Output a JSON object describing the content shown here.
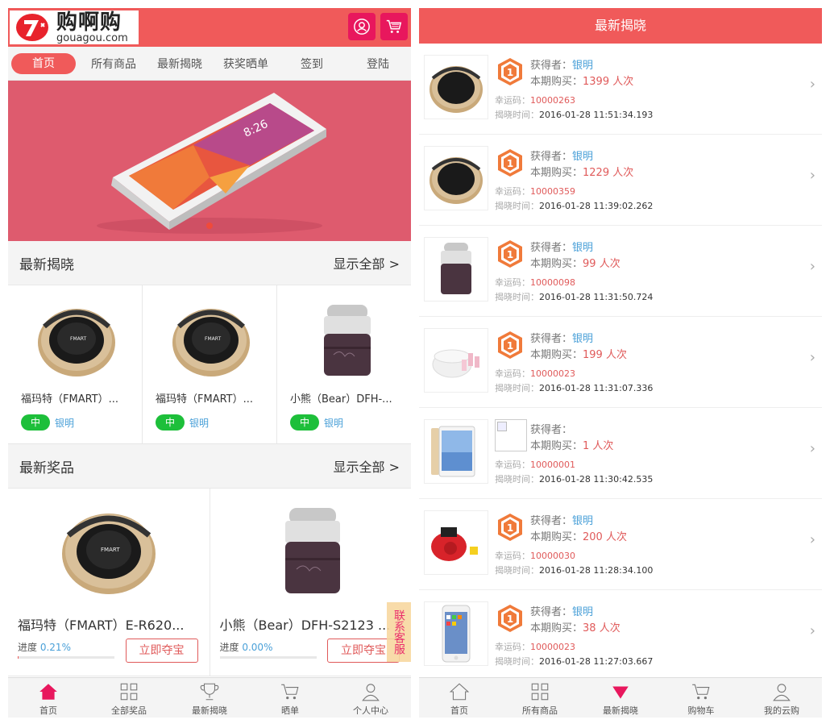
{
  "colors": {
    "brand": "#f05a5a",
    "accent_pink": "#e8175d",
    "win_green": "#1dbf3a",
    "link_blue": "#4aa0d8"
  },
  "left": {
    "logo": {
      "cn": "购啊购",
      "en": "gouagou.com"
    },
    "header_icons": [
      "user-icon",
      "cart-icon"
    ],
    "nav": [
      "首页",
      "所有商品",
      "最新揭晓",
      "获奖晒单",
      "签到",
      "登陆"
    ],
    "latest_reveal": {
      "title": "最新揭晓",
      "more": "显示全部 >",
      "items": [
        {
          "name": "福玛特（FMART）...",
          "badge": "中",
          "winner": "银明",
          "product": "robot-vacuum"
        },
        {
          "name": "福玛特（FMART）...",
          "badge": "中",
          "winner": "银明",
          "product": "robot-vacuum"
        },
        {
          "name": "小熊（Bear）DFH-...",
          "badge": "中",
          "winner": "银明",
          "product": "lunch-box"
        }
      ]
    },
    "latest_prizes": {
      "title": "最新奖品",
      "more": "显示全部 >",
      "items": [
        {
          "name": "福玛特（FMART）E-R620...",
          "progress_label": "进度",
          "progress_text": "0.21%",
          "progress": 0.0021,
          "button": "立即夺宝",
          "product": "robot-vacuum"
        },
        {
          "name": "小熊（Bear）DFH-S2123 ...",
          "progress_label": "进度",
          "progress_text": "0.00%",
          "progress": 0.0,
          "button": "立即夺宝",
          "product": "lunch-box"
        }
      ]
    },
    "customer_service": "联系客服",
    "tabbar": [
      {
        "label": "首页",
        "icon": "home-icon",
        "active": true
      },
      {
        "label": "全部奖品",
        "icon": "grid-icon",
        "active": false
      },
      {
        "label": "最新揭晓",
        "icon": "trophy-icon",
        "active": false
      },
      {
        "label": "晒单",
        "icon": "cart-icon",
        "active": false
      },
      {
        "label": "个人中心",
        "icon": "person-icon",
        "active": false
      }
    ]
  },
  "right": {
    "title": "最新揭晓",
    "labels": {
      "winner": "获得者：",
      "bought": "本期购买：",
      "unit": " 人次",
      "lucky": "幸运码：",
      "time": "揭晓时间："
    },
    "items": [
      {
        "product": "robot-vacuum",
        "rank": "1",
        "winner": "银明",
        "count": "1399",
        "lucky": "10000263",
        "time": "2016-01-28 11:51:34.193"
      },
      {
        "product": "robot-vacuum",
        "rank": "1",
        "winner": "银明",
        "count": "1229",
        "lucky": "10000359",
        "time": "2016-01-28 11:39:02.262"
      },
      {
        "product": "lunch-box",
        "rank": "1",
        "winner": "银明",
        "count": "99",
        "lucky": "10000098",
        "time": "2016-01-28 11:31:50.724"
      },
      {
        "product": "yogurt-maker",
        "rank": "1",
        "winner": "银明",
        "count": "199",
        "lucky": "10000023",
        "time": "2016-01-28 11:31:07.336"
      },
      {
        "product": "ipad",
        "rank": "",
        "winner": "",
        "count": "1",
        "lucky": "10000001",
        "time": "2016-01-28 11:30:42.535"
      },
      {
        "product": "red-appliance",
        "rank": "1",
        "winner": "银明",
        "count": "200",
        "lucky": "10000030",
        "time": "2016-01-28 11:28:34.100"
      },
      {
        "product": "iphone",
        "rank": "1",
        "winner": "银明",
        "count": "38",
        "lucky": "10000023",
        "time": "2016-01-28 11:27:03.667"
      }
    ],
    "tabbar": [
      {
        "label": "首页",
        "icon": "home-icon",
        "active": false
      },
      {
        "label": "所有商品",
        "icon": "grid-icon",
        "active": false
      },
      {
        "label": "最新揭晓",
        "icon": "heart-icon",
        "active": true
      },
      {
        "label": "购物车",
        "icon": "cart-icon",
        "active": false
      },
      {
        "label": "我的云购",
        "icon": "person-icon",
        "active": false
      }
    ]
  }
}
